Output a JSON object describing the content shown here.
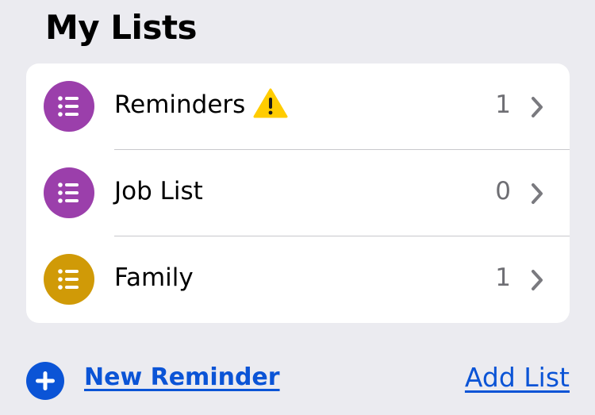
{
  "header": {
    "title": "My Lists"
  },
  "lists": [
    {
      "name": "Reminders",
      "count": "1",
      "icon": "list-bullet-icon",
      "icon_color": "#9b3fab",
      "warning": true,
      "warning_icon": "warning-triangle-icon",
      "warning_color": "#ffcc00"
    },
    {
      "name": "Job List",
      "count": "0",
      "icon": "list-bullet-icon",
      "icon_color": "#9b3fab",
      "warning": false
    },
    {
      "name": "Family",
      "count": "1",
      "icon": "list-bullet-icon",
      "icon_color": "#d09a07",
      "warning": false
    }
  ],
  "footer": {
    "new_reminder_label": "New Reminder",
    "new_reminder_icon": "plus-circle-icon",
    "add_list_label": "Add List",
    "accent_color": "#0b54d6"
  }
}
